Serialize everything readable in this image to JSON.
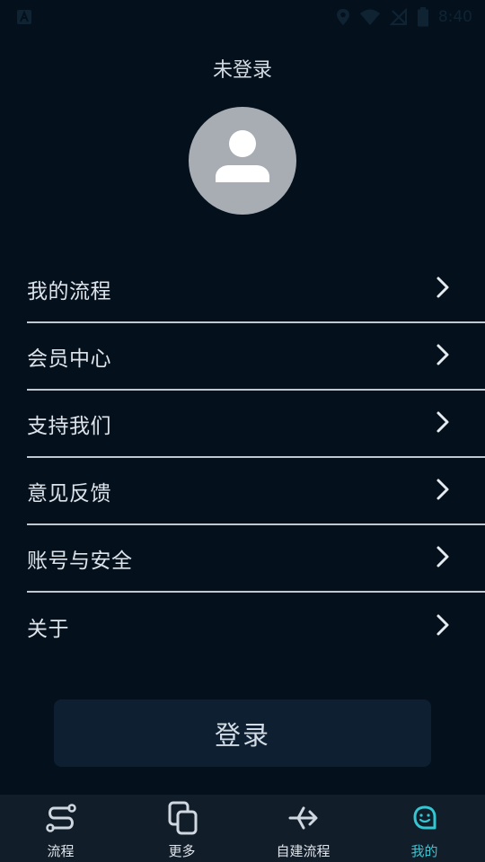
{
  "status_bar": {
    "time": "8:40",
    "icons": [
      "app-notification-icon",
      "location-icon",
      "wifi-icon",
      "no-signal-icon",
      "battery-icon"
    ]
  },
  "page": {
    "title": "未登录"
  },
  "menu": {
    "items": [
      {
        "label": "我的流程",
        "icon": "chevron-right-icon"
      },
      {
        "label": "会员中心",
        "icon": "chevron-right-icon"
      },
      {
        "label": "支持我们",
        "icon": "chevron-right-icon"
      },
      {
        "label": "意见反馈",
        "icon": "chevron-right-icon"
      },
      {
        "label": "账号与安全",
        "icon": "chevron-right-icon"
      },
      {
        "label": "关于",
        "icon": "chevron-right-icon"
      }
    ]
  },
  "login_button": {
    "label": "登录"
  },
  "tab_bar": {
    "tabs": [
      {
        "label": "流程",
        "icon": "flow-icon",
        "active": false
      },
      {
        "label": "更多",
        "icon": "copy-icon",
        "active": false
      },
      {
        "label": "自建流程",
        "icon": "share-arrows-icon",
        "active": false
      },
      {
        "label": "我的",
        "icon": "smile-face-icon",
        "active": true
      }
    ]
  },
  "colors": {
    "background": "#04111d",
    "accent": "#34c6d1",
    "tab_bar": "#121d2a",
    "button": "#0d1f31"
  }
}
